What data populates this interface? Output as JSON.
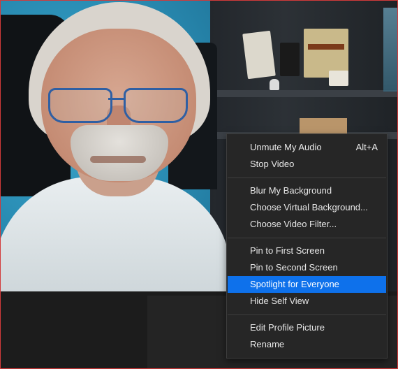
{
  "window": {
    "accent_border_color": "#d23a3a"
  },
  "video_tile": {
    "content": "self-view camera"
  },
  "context_menu": {
    "highlight_color": "#0e71eb",
    "groups": [
      [
        {
          "label": "Unmute My Audio",
          "shortcut": "Alt+A"
        },
        {
          "label": "Stop Video",
          "shortcut": ""
        }
      ],
      [
        {
          "label": "Blur My Background",
          "shortcut": ""
        },
        {
          "label": "Choose Virtual Background...",
          "shortcut": ""
        },
        {
          "label": "Choose Video Filter...",
          "shortcut": ""
        }
      ],
      [
        {
          "label": "Pin to First Screen",
          "shortcut": ""
        },
        {
          "label": "Pin to Second Screen",
          "shortcut": ""
        },
        {
          "label": "Spotlight for Everyone",
          "shortcut": "",
          "highlighted": true
        },
        {
          "label": "Hide Self View",
          "shortcut": ""
        }
      ],
      [
        {
          "label": "Edit Profile Picture",
          "shortcut": ""
        },
        {
          "label": "Rename",
          "shortcut": ""
        }
      ]
    ]
  }
}
